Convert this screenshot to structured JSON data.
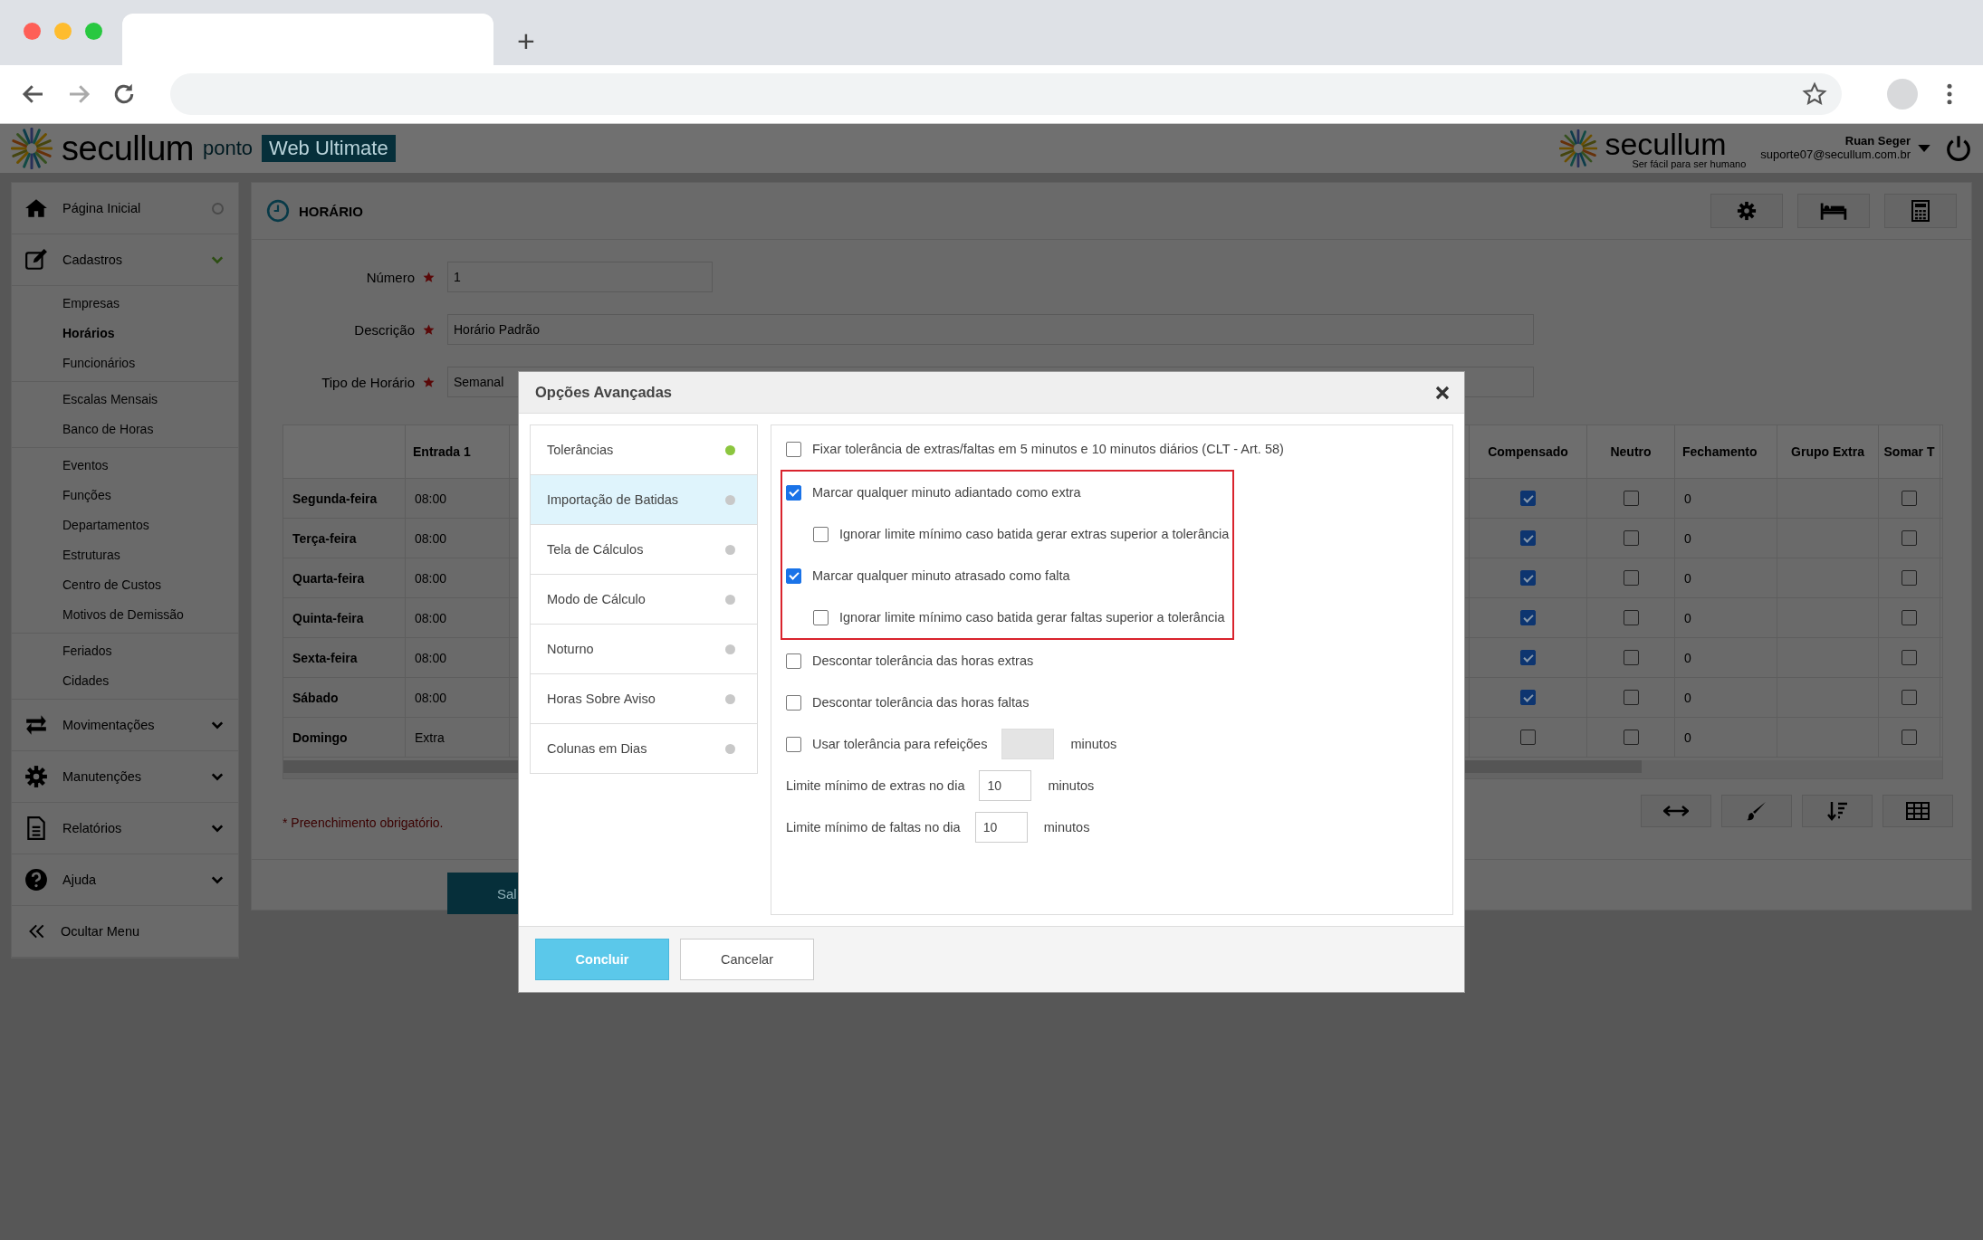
{
  "browser": {
    "new_tab": "+"
  },
  "app_header": {
    "brand": "secullum",
    "product": "ponto",
    "edition": "Web Ultimate",
    "partner_brand": "secullum",
    "partner_tagline": "Ser fácil para ser humano",
    "user_name": "Ruan Seger",
    "user_email": "suporte07@secullum.com.br"
  },
  "sidebar": {
    "items": [
      {
        "kind": "page",
        "label": "Página Inicial"
      },
      {
        "kind": "menu",
        "label": "Cadastros",
        "expanded": true,
        "groups": [
          [
            {
              "label": "Empresas",
              "selected": false
            },
            {
              "label": "Horários",
              "selected": true
            },
            {
              "label": "Funcionários",
              "selected": false
            }
          ],
          [
            {
              "label": "Escalas Mensais",
              "selected": false
            },
            {
              "label": "Banco de Horas",
              "selected": false
            }
          ],
          [
            {
              "label": "Eventos",
              "selected": false
            },
            {
              "label": "Funções",
              "selected": false
            },
            {
              "label": "Departamentos",
              "selected": false
            },
            {
              "label": "Estruturas",
              "selected": false
            },
            {
              "label": "Centro de Custos",
              "selected": false
            },
            {
              "label": "Motivos de Demissão",
              "selected": false
            }
          ],
          [
            {
              "label": "Feriados",
              "selected": false
            },
            {
              "label": "Cidades",
              "selected": false
            }
          ]
        ]
      },
      {
        "kind": "menu",
        "label": "Movimentações",
        "expanded": false
      },
      {
        "kind": "menu",
        "label": "Manutenções",
        "expanded": false
      },
      {
        "kind": "menu",
        "label": "Relatórios",
        "expanded": false
      },
      {
        "kind": "menu",
        "label": "Ajuda",
        "expanded": false
      },
      {
        "kind": "action",
        "label": "Ocultar Menu"
      }
    ]
  },
  "page": {
    "title": "HORÁRIO",
    "form": [
      {
        "label": "Número",
        "required": true,
        "value": "1"
      },
      {
        "label": "Descrição",
        "required": true,
        "value": "Horário Padrão"
      },
      {
        "label": "Tipo de Horário",
        "required": true,
        "value": "Semanal"
      }
    ],
    "table": {
      "columns": [
        "",
        "Entrada 1",
        "Compensado",
        "Neutro",
        "Fechamento",
        "Grupo Extra",
        "Somar T"
      ],
      "rows": [
        {
          "day": "Segunda-feira",
          "entrada_1": "08:00",
          "compensado": true,
          "neutro": false,
          "fechamento": "0",
          "somar": false
        },
        {
          "day": "Terça-feira",
          "entrada_1": "08:00",
          "compensado": true,
          "neutro": false,
          "fechamento": "0",
          "somar": false
        },
        {
          "day": "Quarta-feira",
          "entrada_1": "08:00",
          "compensado": true,
          "neutro": false,
          "fechamento": "0",
          "somar": false
        },
        {
          "day": "Quinta-feira",
          "entrada_1": "08:00",
          "compensado": true,
          "neutro": false,
          "fechamento": "0",
          "somar": false
        },
        {
          "day": "Sexta-feira",
          "entrada_1": "08:00",
          "compensado": true,
          "neutro": false,
          "fechamento": "0",
          "somar": false
        },
        {
          "day": "Sábado",
          "entrada_1": "08:00",
          "compensado": true,
          "neutro": false,
          "fechamento": "0",
          "somar": false
        },
        {
          "day": "Domingo",
          "entrada_1": "Extra",
          "compensado": false,
          "neutro": false,
          "fechamento": "0",
          "somar": false
        }
      ]
    },
    "required_note": "* Preenchimento obrigatório.",
    "save_button": "Sal"
  },
  "dialog": {
    "title": "Opções Avançadas",
    "nav": [
      {
        "label": "Tolerâncias",
        "selected": false,
        "color": "#8cc63f"
      },
      {
        "label": "Importação de Batidas",
        "selected": true,
        "color": "#c8c8c8"
      },
      {
        "label": "Tela de Cálculos",
        "selected": false,
        "color": "#c8c8c8"
      },
      {
        "label": "Modo de Cálculo",
        "selected": false,
        "color": "#c8c8c8"
      },
      {
        "label": "Noturno",
        "selected": false,
        "color": "#c8c8c8"
      },
      {
        "label": "Horas Sobre Aviso",
        "selected": false,
        "color": "#c8c8c8"
      },
      {
        "label": "Colunas em Dias",
        "selected": false,
        "color": "#c8c8c8"
      }
    ],
    "options": [
      {
        "kind": "checkbox",
        "label": "Fixar tolerância de extras/faltas em 5 minutos e 10 minutos diários (CLT - Art. 58)",
        "checked": false
      },
      {
        "kind": "group",
        "highlighted": true,
        "items": [
          {
            "kind": "checkbox",
            "label": "Marcar qualquer minuto adiantado como extra",
            "checked": true,
            "children": [
              {
                "kind": "checkbox",
                "label": "Ignorar limite mínimo caso batida gerar extras superior a tolerância",
                "checked": false
              }
            ]
          },
          {
            "kind": "checkbox",
            "label": "Marcar qualquer minuto atrasado como falta",
            "checked": true,
            "children": [
              {
                "kind": "checkbox",
                "label": "Ignorar limite mínimo caso batida gerar faltas superior a tolerância",
                "checked": false
              }
            ]
          }
        ]
      },
      {
        "kind": "checkbox",
        "label": "Descontar tolerância das horas extras",
        "checked": false
      },
      {
        "kind": "checkbox",
        "label": "Descontar tolerância das horas faltas",
        "checked": false
      },
      {
        "kind": "checkbox_field",
        "label": "Usar tolerância para refeições",
        "checked": false,
        "disabled": true,
        "unit": "minutos"
      },
      {
        "kind": "field",
        "label": "Limite mínimo de extras no dia",
        "value": "10",
        "unit": "minutos"
      },
      {
        "kind": "field",
        "label": "Limite mínimo de faltas no dia",
        "value": "10",
        "unit": "minutos"
      }
    ],
    "buttons": [
      {
        "label": "Concluir",
        "kind": "primary"
      },
      {
        "label": "Cancelar",
        "kind": "secondary"
      }
    ]
  }
}
